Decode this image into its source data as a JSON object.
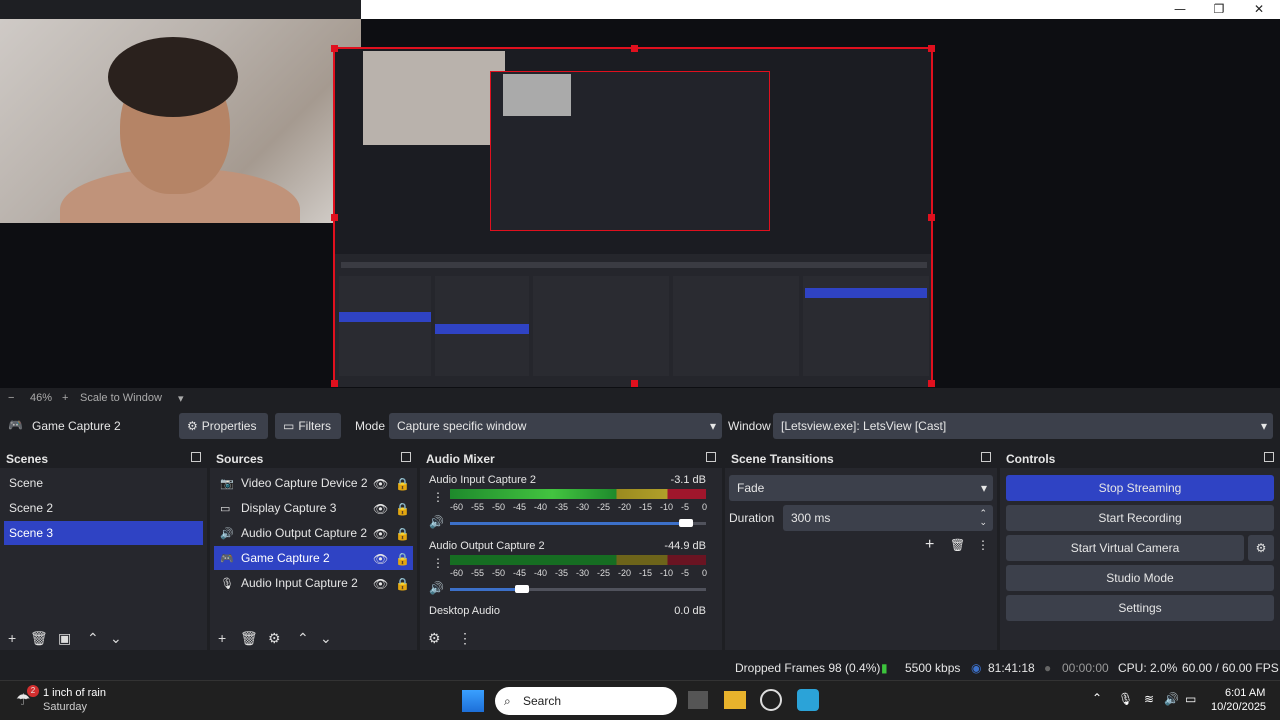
{
  "window": {
    "minimize": "—",
    "maximize": "❐",
    "close": "✕"
  },
  "toolbar": {
    "zoom": "46%",
    "minus": "−",
    "plus": "+",
    "scale_mode": "Scale to Window",
    "caret": "▾"
  },
  "source_bar": {
    "source_name": "Game Capture 2",
    "properties": "Properties",
    "filters": "Filters",
    "mode_label": "Mode",
    "mode_value": "Capture specific window",
    "window_label": "Window",
    "window_value": "[Letsview.exe]: LetsView [Cast]"
  },
  "scenes": {
    "title": "Scenes",
    "items": [
      {
        "label": "Scene"
      },
      {
        "label": "Scene 2"
      },
      {
        "label": "Scene 3"
      }
    ]
  },
  "sources": {
    "title": "Sources",
    "items": [
      {
        "label": "Video Capture Device 2"
      },
      {
        "label": "Display Capture 3"
      },
      {
        "label": "Audio Output Capture 2"
      },
      {
        "label": "Game Capture 2"
      },
      {
        "label": "Audio Input Capture 2"
      }
    ]
  },
  "mixer": {
    "title": "Audio Mixer",
    "channels": [
      {
        "name": "Audio Input Capture 2",
        "db": "-3.1 dB",
        "volume": 0.95
      },
      {
        "name": "Audio Output Capture 2",
        "db": "-44.9 dB",
        "volume": 0.31
      },
      {
        "name": "Desktop Audio",
        "db": "0.0 dB"
      }
    ],
    "ticks": [
      "-60",
      "-55",
      "-50",
      "-45",
      "-40",
      "-35",
      "-30",
      "-25",
      "-20",
      "-15",
      "-10",
      "-5",
      "0"
    ]
  },
  "transitions": {
    "title": "Scene Transitions",
    "selected": "Fade",
    "duration_label": "Duration",
    "duration_value": "300 ms"
  },
  "controls": {
    "title": "Controls",
    "stop_streaming": "Stop Streaming",
    "start_recording": "Start Recording",
    "start_virtual_camera": "Start Virtual Camera",
    "studio_mode": "Studio Mode",
    "settings": "Settings"
  },
  "status": {
    "dropped_frames": "Dropped Frames 98 (0.4%)",
    "bitrate": "5500 kbps",
    "stream_time": "81:41:18",
    "record_time": "00:00:00",
    "cpu": "CPU: 2.0%",
    "fps": "60.00 / 60.00 FPS"
  },
  "taskbar": {
    "weather_title": "1 inch of rain",
    "weather_sub": "Saturday",
    "weather_badge": "2",
    "search": "Search",
    "time": "6:01 AM",
    "date": "10/20/2025"
  },
  "colors": {
    "accent": "#2f43c4",
    "live_red": "#e0101e",
    "panel": "#26272d",
    "bg": "#1e1f23"
  }
}
